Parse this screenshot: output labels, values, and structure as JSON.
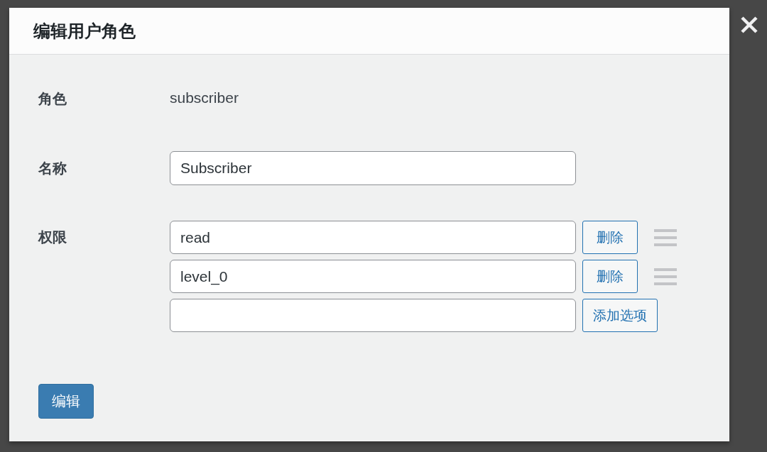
{
  "dialog": {
    "title": "编辑用户角色"
  },
  "fields": [
    {
      "kind": "text",
      "label": "角色",
      "value": "subscriber"
    },
    {
      "kind": "input",
      "label": "名称",
      "value": "Subscriber"
    },
    {
      "kind": "list",
      "label": "权限",
      "items": [
        {
          "value": "read",
          "button": "删除"
        },
        {
          "value": "level_0",
          "button": "删除"
        }
      ],
      "new_item": {
        "button": "添加选项"
      }
    }
  ],
  "submit_button": "编辑"
}
